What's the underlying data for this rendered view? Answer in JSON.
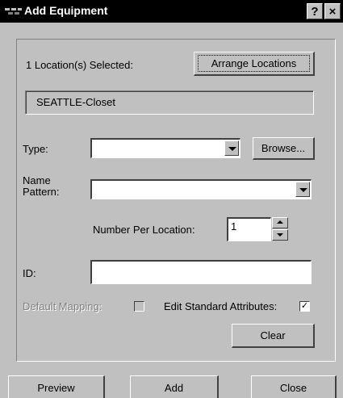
{
  "window": {
    "title": "Add Equipment",
    "help_label": "?",
    "close_label": "×"
  },
  "selection": {
    "status": "1 Location(s) Selected:",
    "arrange_label": "Arrange Locations",
    "selected_location": "SEATTLE-Closet"
  },
  "type": {
    "label": "Type:",
    "value": "",
    "browse_label": "Browse..."
  },
  "name_pattern": {
    "label_line1": "Name",
    "label_line2": "Pattern:",
    "value": ""
  },
  "number_per_location": {
    "label": "Number Per Location:",
    "value": "1"
  },
  "id": {
    "label": "ID:",
    "value": ""
  },
  "default_mapping": {
    "label": "Default Mapping:",
    "checked": false,
    "enabled": false
  },
  "edit_standard_attributes": {
    "label": "Edit Standard Attributes:",
    "checked": true,
    "mark": "✓"
  },
  "buttons": {
    "clear": "Clear",
    "preview": "Preview",
    "add": "Add",
    "close": "Close"
  },
  "colors": {
    "dialog_bg": "#c0c0c0",
    "titlebar_bg": "#000000",
    "disabled_text": "#808080"
  }
}
